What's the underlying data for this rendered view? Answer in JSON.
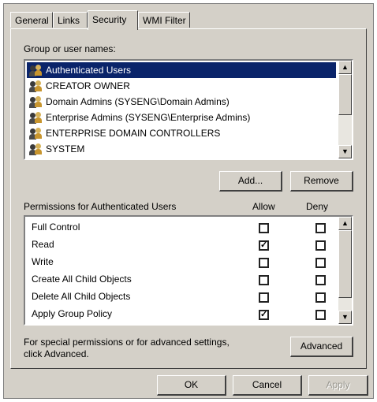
{
  "tabs": [
    {
      "label": "General"
    },
    {
      "label": "Links"
    },
    {
      "label": "Security",
      "active": true
    },
    {
      "label": "WMI Filter"
    }
  ],
  "groups": {
    "label": "Group or user names:",
    "items": [
      {
        "name": "Authenticated Users",
        "selected": true
      },
      {
        "name": "CREATOR OWNER"
      },
      {
        "name": "Domain Admins (SYSENG\\Domain Admins)"
      },
      {
        "name": "Enterprise Admins (SYSENG\\Enterprise Admins)"
      },
      {
        "name": "ENTERPRISE DOMAIN CONTROLLERS"
      },
      {
        "name": "SYSTEM"
      }
    ]
  },
  "buttons": {
    "add": "Add...",
    "remove": "Remove",
    "advanced": "Advanced",
    "ok": "OK",
    "cancel": "Cancel",
    "apply": "Apply"
  },
  "permissions": {
    "header": "Permissions for Authenticated Users",
    "allow_header": "Allow",
    "deny_header": "Deny",
    "rows": [
      {
        "name": "Full Control",
        "allow": false,
        "deny": false
      },
      {
        "name": "Read",
        "allow": true,
        "deny": false
      },
      {
        "name": "Write",
        "allow": false,
        "deny": false
      },
      {
        "name": "Create All Child Objects",
        "allow": false,
        "deny": false
      },
      {
        "name": "Delete All Child Objects",
        "allow": false,
        "deny": false
      },
      {
        "name": "Apply Group Policy",
        "allow": true,
        "deny": false
      }
    ]
  },
  "special_note": {
    "line1": "For special permissions or for advanced settings,",
    "line2": "click Advanced."
  },
  "check_glyph": "✓",
  "icons": {
    "group": "group-icon",
    "scroll_up": "scroll-up-arrow-icon",
    "scroll_down": "scroll-down-arrow-icon"
  }
}
